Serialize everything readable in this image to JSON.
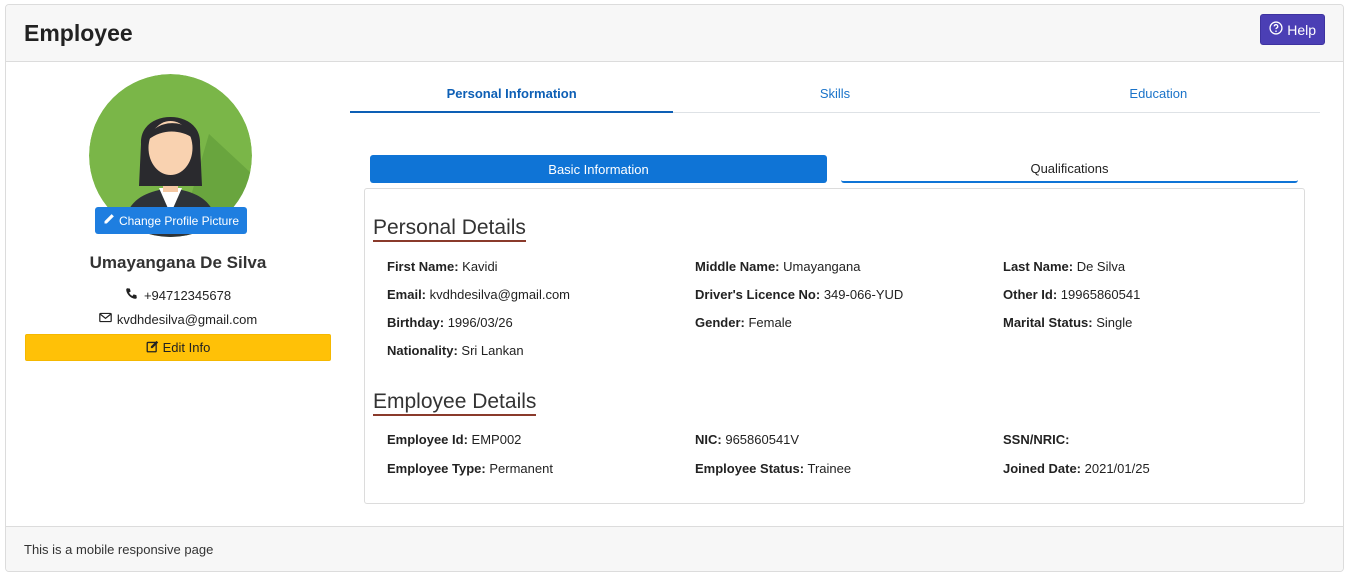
{
  "header": {
    "title": "Employee",
    "help_label": "Help"
  },
  "profile": {
    "change_picture_label": "Change Profile Picture",
    "name": "Umayangana De Silva",
    "phone": "+94712345678",
    "email": "kvdhdesilva@gmail.com",
    "edit_label": "Edit Info"
  },
  "tabs": [
    "Personal Information",
    "Skills",
    "Education"
  ],
  "subtabs": [
    "Basic Information",
    "Qualifications"
  ],
  "personal": {
    "title": "Personal Details",
    "first_name_label": "First Name:",
    "first_name": "Kavidi",
    "middle_name_label": "Middle Name:",
    "middle_name": "Umayangana",
    "last_name_label": "Last Name:",
    "last_name": "De Silva",
    "email_label": "Email:",
    "email": "kvdhdesilva@gmail.com",
    "licence_label": "Driver's Licence No:",
    "licence": "349-066-YUD",
    "other_id_label": "Other Id:",
    "other_id": "19965860541",
    "birthday_label": "Birthday:",
    "birthday": "1996/03/26",
    "gender_label": "Gender:",
    "gender": "Female",
    "marital_label": "Marital Status:",
    "marital": "Single",
    "nationality_label": "Nationality:",
    "nationality": "Sri Lankan"
  },
  "employee": {
    "title": "Employee Details",
    "emp_id_label": "Employee Id:",
    "emp_id": "EMP002",
    "nic_label": "NIC:",
    "nic": "965860541V",
    "ssn_label": "SSN/NRIC:",
    "ssn": "",
    "type_label": "Employee Type:",
    "type": "Permanent",
    "status_label": "Employee Status:",
    "status": "Trainee",
    "joined_label": "Joined Date:",
    "joined": "2021/01/25"
  },
  "footer": {
    "text": "This is a mobile responsive page"
  },
  "colors": {
    "primary": "#0f74d6",
    "help": "#4b3fb5",
    "warning": "#ffc107",
    "avatar_bg": "#7ab648"
  }
}
